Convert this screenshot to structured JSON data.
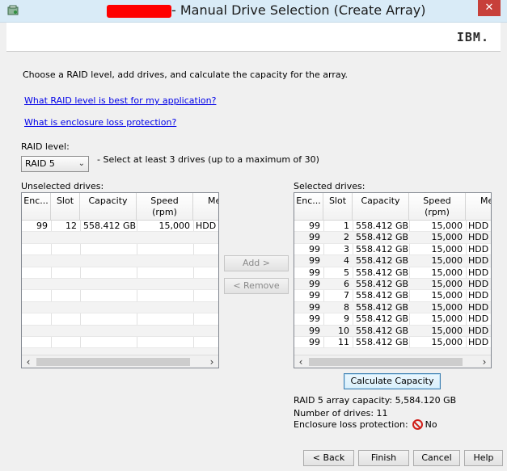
{
  "window": {
    "title": "- Manual Drive Selection (Create Array)",
    "close_glyph": "✕",
    "logo": "IBM."
  },
  "main": {
    "instruction": "Choose a RAID level, add drives, and calculate the capacity for the array.",
    "link_raid": "What RAID level is best for my application?",
    "link_enclosure": "What is enclosure loss protection?",
    "raid_label": "RAID level:",
    "raid_value": "RAID 5",
    "raid_hint": "- Select at least 3 drives (up to a maximum of 30)",
    "unselected_label": "Unselected drives:",
    "selected_label": "Selected drives:"
  },
  "columns": [
    "Enc...",
    "Slot",
    "Capacity",
    "Speed (rpm)",
    "Media"
  ],
  "unselected_rows": [
    {
      "enc": "99",
      "slot": "12",
      "capacity": "558.412 GB",
      "speed": "15,000",
      "media": "HDD"
    }
  ],
  "selected_rows": [
    {
      "enc": "99",
      "slot": "1",
      "capacity": "558.412 GB",
      "speed": "15,000",
      "media": "HDD"
    },
    {
      "enc": "99",
      "slot": "2",
      "capacity": "558.412 GB",
      "speed": "15,000",
      "media": "HDD"
    },
    {
      "enc": "99",
      "slot": "3",
      "capacity": "558.412 GB",
      "speed": "15,000",
      "media": "HDD"
    },
    {
      "enc": "99",
      "slot": "4",
      "capacity": "558.412 GB",
      "speed": "15,000",
      "media": "HDD"
    },
    {
      "enc": "99",
      "slot": "5",
      "capacity": "558.412 GB",
      "speed": "15,000",
      "media": "HDD"
    },
    {
      "enc": "99",
      "slot": "6",
      "capacity": "558.412 GB",
      "speed": "15,000",
      "media": "HDD"
    },
    {
      "enc": "99",
      "slot": "7",
      "capacity": "558.412 GB",
      "speed": "15,000",
      "media": "HDD"
    },
    {
      "enc": "99",
      "slot": "8",
      "capacity": "558.412 GB",
      "speed": "15,000",
      "media": "HDD"
    },
    {
      "enc": "99",
      "slot": "9",
      "capacity": "558.412 GB",
      "speed": "15,000",
      "media": "HDD"
    },
    {
      "enc": "99",
      "slot": "10",
      "capacity": "558.412 GB",
      "speed": "15,000",
      "media": "HDD"
    },
    {
      "enc": "99",
      "slot": "11",
      "capacity": "558.412 GB",
      "speed": "15,000",
      "media": "HDD"
    }
  ],
  "buttons": {
    "add": "Add >",
    "remove": "< Remove",
    "calculate": "Calculate Capacity",
    "back": "< Back",
    "finish": "Finish",
    "cancel": "Cancel",
    "help": "Help"
  },
  "summary": {
    "capacity": "RAID 5 array capacity: 5,584.120 GB",
    "drives": "Number of drives: 11",
    "enclosure_label": "Enclosure loss protection:",
    "enclosure_value": "No"
  },
  "colors": {
    "title_bar": "#d9ebf7",
    "link": "#0000e8",
    "no_icon": "#d0201a"
  }
}
